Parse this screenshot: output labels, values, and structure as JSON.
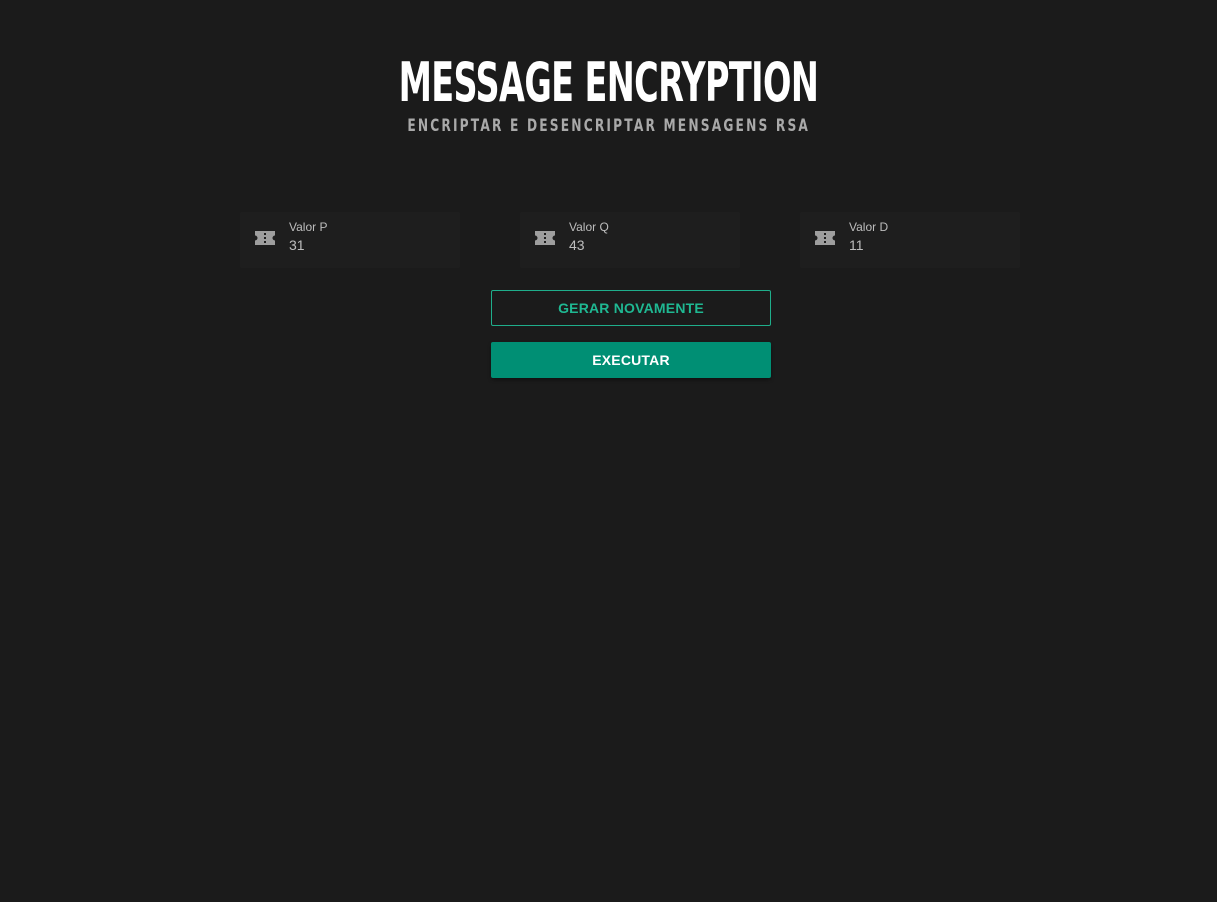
{
  "header": {
    "title": "MESSAGE ENCRYPTION",
    "subtitle": "ENCRIPTAR E DESENCRIPTAR MENSAGENS RSA"
  },
  "fields": [
    {
      "label": "Valor P",
      "value": "31",
      "icon": "ticket-icon"
    },
    {
      "label": "Valor Q",
      "value": "43",
      "icon": "ticket-icon"
    },
    {
      "label": "Valor D",
      "value": "11",
      "icon": "ticket-icon"
    }
  ],
  "buttons": {
    "regenerate_label": "GERAR NOVAMENTE",
    "execute_label": "EXECUTAR"
  },
  "colors": {
    "background": "#1b1b1b",
    "accent": "#008f74",
    "accent_outline": "#1fae8b"
  }
}
